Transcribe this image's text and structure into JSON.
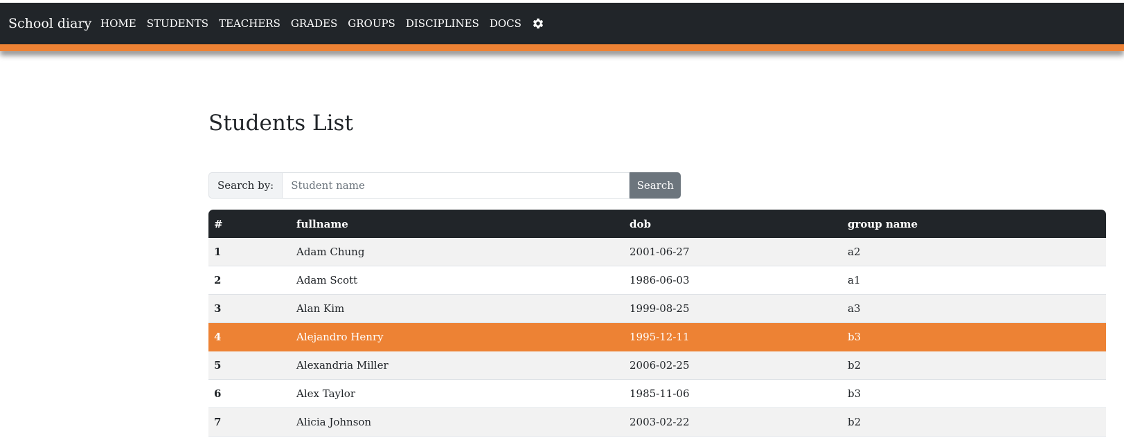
{
  "header": {
    "brand": "School diary",
    "nav": [
      "HOME",
      "STUDENTS",
      "TEACHERS",
      "GRADES",
      "GROUPS",
      "DISCIPLINES",
      "DOCS"
    ],
    "settings_icon": "gear-icon",
    "accent_color": "#ed8234",
    "bg_color": "#212529"
  },
  "main": {
    "title": "Students List",
    "search": {
      "label": "Search by:",
      "placeholder": "Student name",
      "value": "",
      "button": "Search"
    },
    "table": {
      "headers": [
        "#",
        "fullname",
        "dob",
        "group name"
      ],
      "rows": [
        {
          "idx": "1",
          "fullname": "Adam Chung",
          "dob": "2001-06-27",
          "group": "a2"
        },
        {
          "idx": "2",
          "fullname": "Adam Scott",
          "dob": "1986-06-03",
          "group": "a1"
        },
        {
          "idx": "3",
          "fullname": "Alan Kim",
          "dob": "1999-08-25",
          "group": "a3"
        },
        {
          "idx": "4",
          "fullname": "Alejandro Henry",
          "dob": "1995-12-11",
          "group": "b3"
        },
        {
          "idx": "5",
          "fullname": "Alexandria Miller",
          "dob": "2006-02-25",
          "group": "b2"
        },
        {
          "idx": "6",
          "fullname": "Alex Taylor",
          "dob": "1985-11-06",
          "group": "b3"
        },
        {
          "idx": "7",
          "fullname": "Alicia Johnson",
          "dob": "2003-02-22",
          "group": "b2"
        }
      ],
      "selected_index": 3,
      "selected_color": "#ed8234"
    }
  }
}
